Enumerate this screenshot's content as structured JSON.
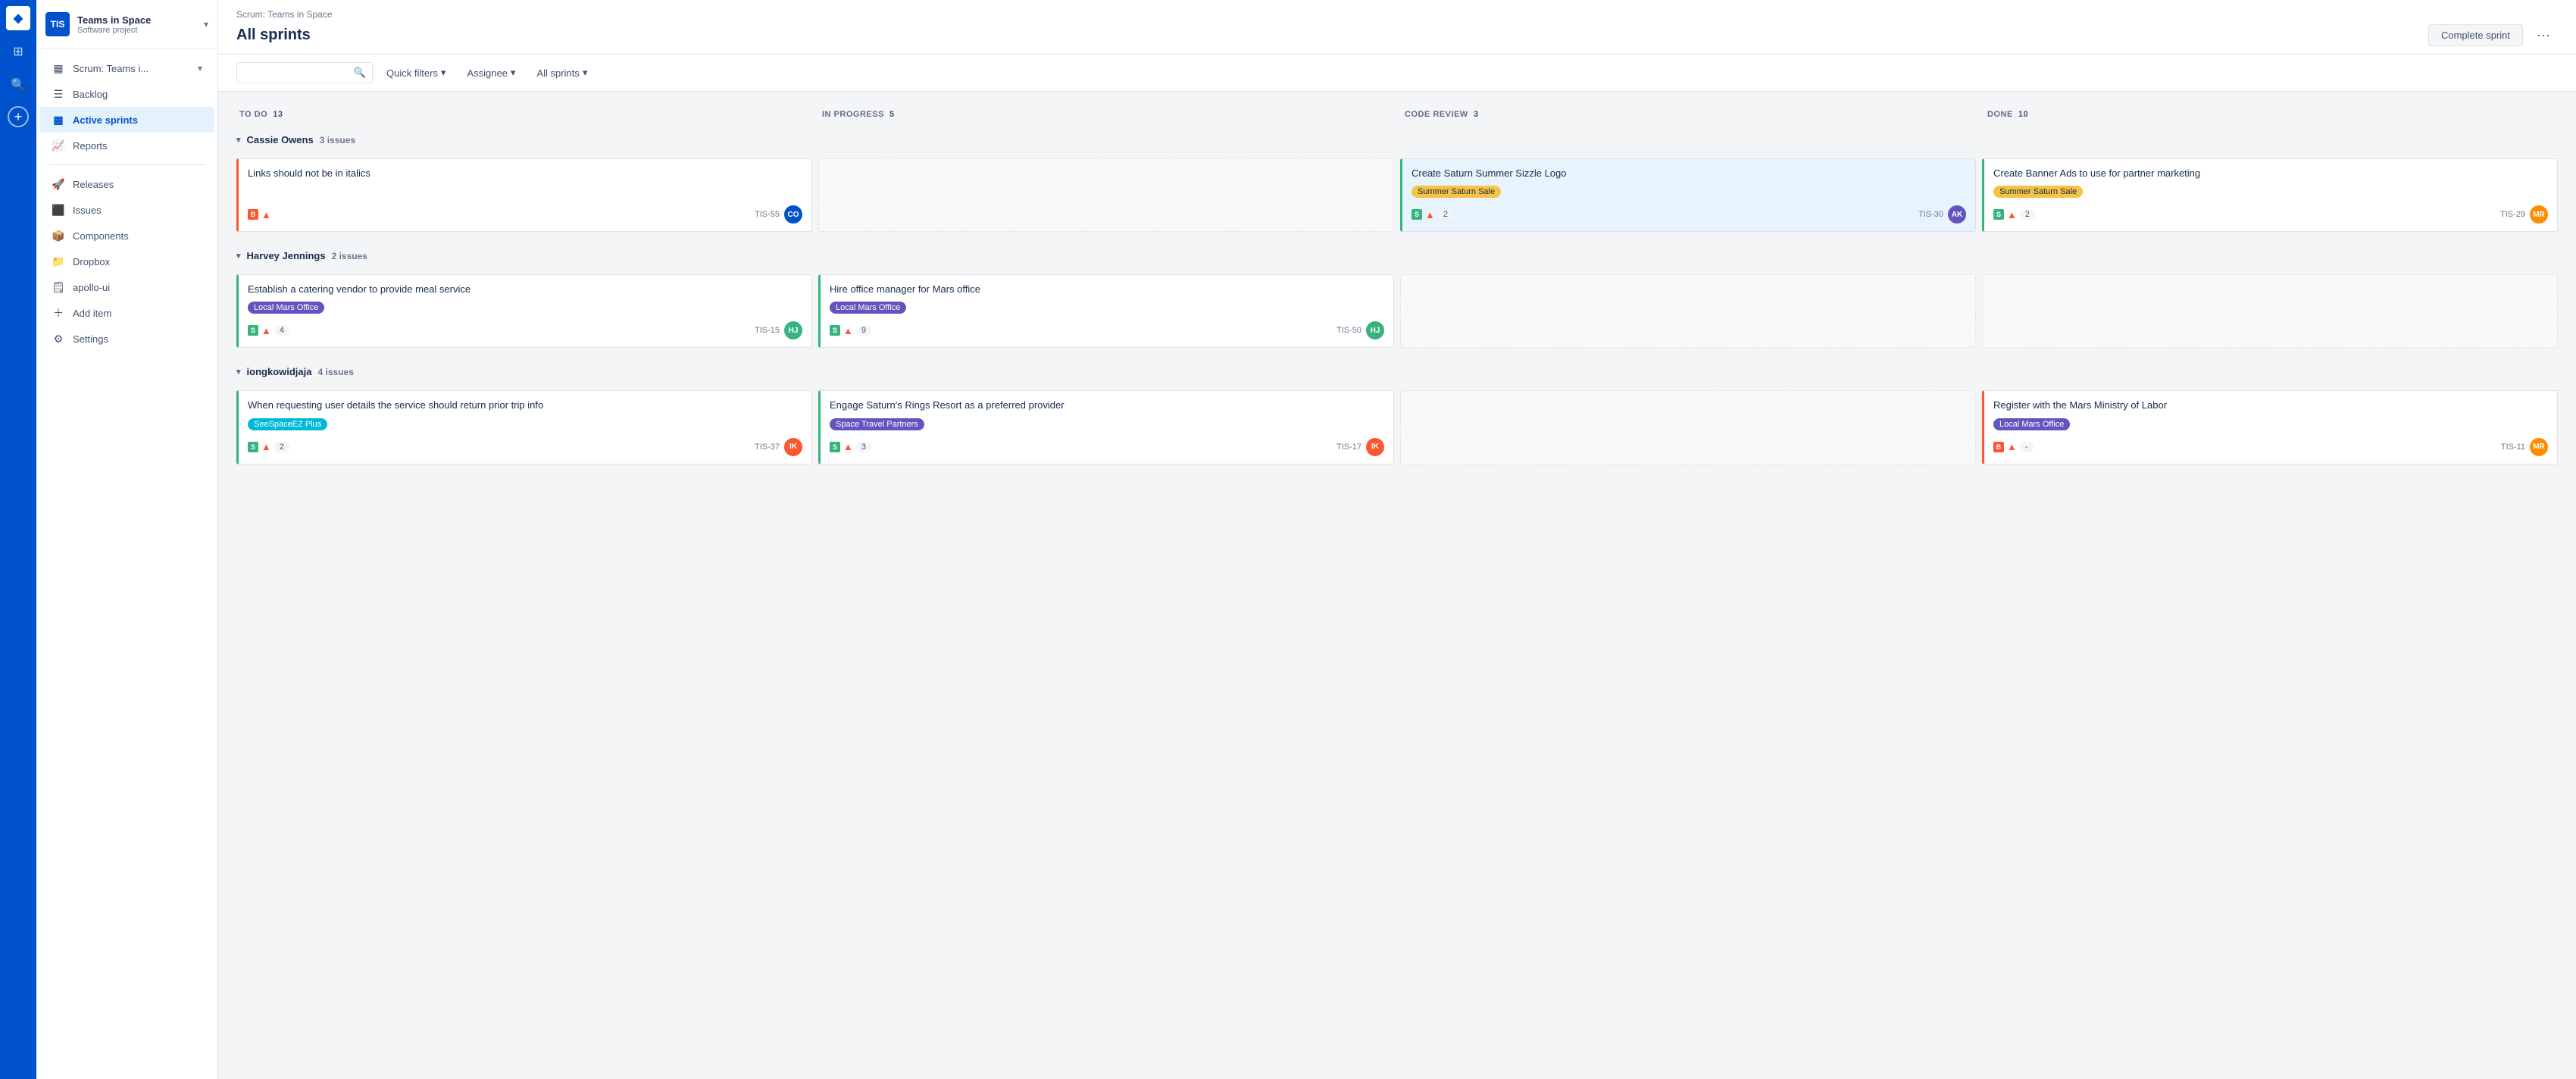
{
  "nav": {
    "logo": "◆",
    "rail_items": [
      "⊞",
      "🔍",
      "+"
    ]
  },
  "sidebar": {
    "project_icon": "TIS",
    "project_name": "Teams in Space",
    "project_sub": "Software project",
    "items": [
      {
        "id": "scrum",
        "label": "Scrum: Teams i...",
        "icon": "▦",
        "active": false,
        "hasChevron": true
      },
      {
        "id": "backlog",
        "label": "Backlog",
        "icon": "☰",
        "active": false
      },
      {
        "id": "active-sprints",
        "label": "Active sprints",
        "icon": "▦",
        "active": true
      },
      {
        "id": "reports",
        "label": "Reports",
        "icon": "📈",
        "active": false
      },
      {
        "id": "releases",
        "label": "Releases",
        "icon": "🚀",
        "active": false
      },
      {
        "id": "issues",
        "label": "Issues",
        "icon": "⬛",
        "active": false
      },
      {
        "id": "components",
        "label": "Components",
        "icon": "📦",
        "active": false
      },
      {
        "id": "dropbox",
        "label": "Dropbox",
        "icon": "📁",
        "active": false
      },
      {
        "id": "apollo-ui",
        "label": "apollo-ui",
        "icon": "🗒",
        "active": false
      },
      {
        "id": "add-item",
        "label": "Add item",
        "icon": "＋",
        "active": false
      },
      {
        "id": "settings",
        "label": "Settings",
        "icon": "⚙",
        "active": false
      }
    ]
  },
  "topbar": {
    "breadcrumb": "Scrum: Teams in Space",
    "title": "All sprints",
    "complete_sprint": "Complete sprint",
    "more": "···"
  },
  "filters": {
    "search_placeholder": "",
    "quick_filters": "Quick filters",
    "assignee": "Assignee",
    "all_sprints": "All sprints"
  },
  "columns": [
    {
      "id": "todo",
      "label": "TO DO",
      "count": 13
    },
    {
      "id": "inprogress",
      "label": "IN PROGRESS",
      "count": 5
    },
    {
      "id": "codereview",
      "label": "CODE REVIEW",
      "count": 3
    },
    {
      "id": "done",
      "label": "DONE",
      "count": 10
    }
  ],
  "swimlanes": [
    {
      "id": "cassie",
      "name": "Cassie Owens",
      "issue_count": "3 issues",
      "rows": [
        [
          {
            "title": "Links should not be in italics",
            "tag": null,
            "tag_type": null,
            "left_color": "red",
            "icons": [
              "bug",
              "priority-high"
            ],
            "count": null,
            "id": "TIS-55",
            "avatar": "CO",
            "avatar_color": "blue"
          },
          null,
          {
            "title": "Create Saturn Summer Sizzle Logo",
            "tag": "Summer Saturn Sale",
            "tag_type": "yellow",
            "left_color": "blue",
            "icons": [
              "story",
              "priority-high"
            ],
            "count": "2",
            "id": "TIS-30",
            "avatar": "AK",
            "avatar_color": "purple",
            "highlighted": true
          },
          {
            "title": "Create Banner Ads to use for partner marketing",
            "tag": "Summer Saturn Sale",
            "tag_type": "yellow",
            "left_color": "green",
            "icons": [
              "story",
              "priority-high"
            ],
            "count": "2",
            "id": "TIS-29",
            "avatar": "MR",
            "avatar_color": "orange"
          }
        ]
      ]
    },
    {
      "id": "harvey",
      "name": "Harvey Jennings",
      "issue_count": "2 issues",
      "rows": [
        [
          {
            "title": "Establish a catering vendor to provide meal service",
            "tag": "Local Mars Office",
            "tag_type": "purple",
            "left_color": "green",
            "icons": [
              "story",
              "priority-high"
            ],
            "count": "4",
            "id": "TIS-15",
            "avatar": "HJ",
            "avatar_color": "green"
          },
          {
            "title": "Hire office manager for Mars office",
            "tag": "Local Mars Office",
            "tag_type": "purple",
            "left_color": "green",
            "icons": [
              "story",
              "priority-high"
            ],
            "count": "9",
            "id": "TIS-50",
            "avatar": "HJ",
            "avatar_color": "green"
          },
          null,
          null
        ]
      ]
    },
    {
      "id": "iongkowidjaja",
      "name": "iongkowidjaja",
      "issue_count": "4 issues",
      "rows": [
        [
          {
            "title": "When requesting user details the service should return prior trip info",
            "tag": "SeeSpaceEZ Plus",
            "tag_type": "teal",
            "left_color": "green",
            "icons": [
              "story",
              "priority-high"
            ],
            "count": "2",
            "id": "TIS-37",
            "avatar": "IK",
            "avatar_color": "red"
          },
          {
            "title": "Engage Saturn's Rings Resort as a preferred provider",
            "tag": "Space Travel Partners",
            "tag_type": "purple",
            "left_color": "green",
            "icons": [
              "story",
              "priority-high"
            ],
            "count": "3",
            "id": "TIS-17",
            "avatar": "IK",
            "avatar_color": "red"
          },
          null,
          {
            "title": "Register with the Mars Ministry of Labor",
            "tag": "Local Mars Office",
            "tag_type": "purple",
            "left_color": "red",
            "icons": [
              "bug",
              "priority-high"
            ],
            "count": "-",
            "id": "TIS-11",
            "avatar": "MR",
            "avatar_color": "orange"
          }
        ]
      ]
    }
  ]
}
